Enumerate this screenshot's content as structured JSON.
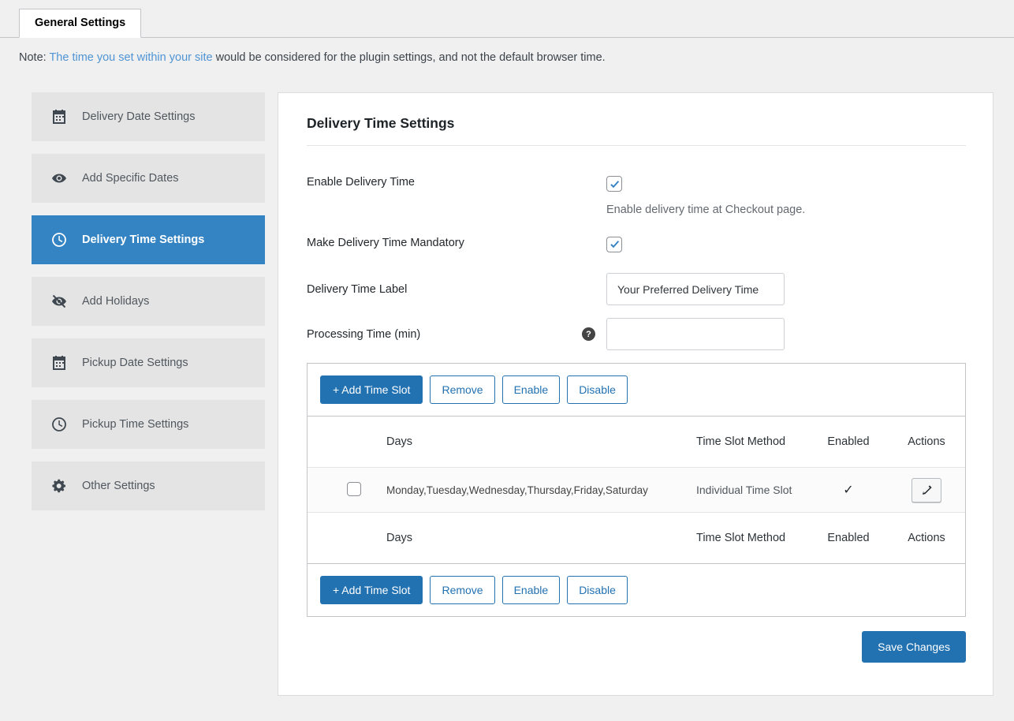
{
  "colors": {
    "accent": "#2271b1",
    "sidebar_active": "#3484c4",
    "link": "#4f94d4"
  },
  "tabs": {
    "general": "General Settings"
  },
  "note": {
    "prefix": "Note: ",
    "link": "The time you set within your site",
    "suffix": " would be considered for the plugin settings, and not the default browser time."
  },
  "sidebar": {
    "items": [
      {
        "label": "Delivery Date Settings",
        "icon": "calendar-icon",
        "active": false
      },
      {
        "label": "Add Specific Dates",
        "icon": "eye-icon",
        "active": false
      },
      {
        "label": "Delivery Time Settings",
        "icon": "clock-icon",
        "active": true
      },
      {
        "label": "Add Holidays",
        "icon": "eye-slash-icon",
        "active": false
      },
      {
        "label": "Pickup Date Settings",
        "icon": "calendar-icon",
        "active": false
      },
      {
        "label": "Pickup Time Settings",
        "icon": "clock-icon",
        "active": false
      },
      {
        "label": "Other Settings",
        "icon": "gear-icon",
        "active": false
      }
    ]
  },
  "panel": {
    "title": "Delivery Time Settings",
    "fields": {
      "enable": {
        "label": "Enable Delivery Time",
        "checked": true,
        "description": "Enable delivery time at Checkout page."
      },
      "mandatory": {
        "label": "Make Delivery Time Mandatory",
        "checked": true
      },
      "time_label": {
        "label": "Delivery Time Label",
        "value": "Your Preferred Delivery Time"
      },
      "processing": {
        "label": "Processing Time (min)",
        "value": "",
        "help": "?"
      }
    },
    "table": {
      "toolbar": {
        "add": "+ Add Time Slot",
        "remove": "Remove",
        "enable": "Enable",
        "disable": "Disable"
      },
      "headers": {
        "days": "Days",
        "method": "Time Slot Method",
        "enabled": "Enabled",
        "actions": "Actions"
      },
      "rows": [
        {
          "checked": false,
          "days": "Monday,Tuesday,Wednesday,Thursday,Friday,Saturday",
          "method": "Individual Time Slot",
          "enabled": "✓"
        }
      ]
    },
    "save": "Save Changes"
  }
}
